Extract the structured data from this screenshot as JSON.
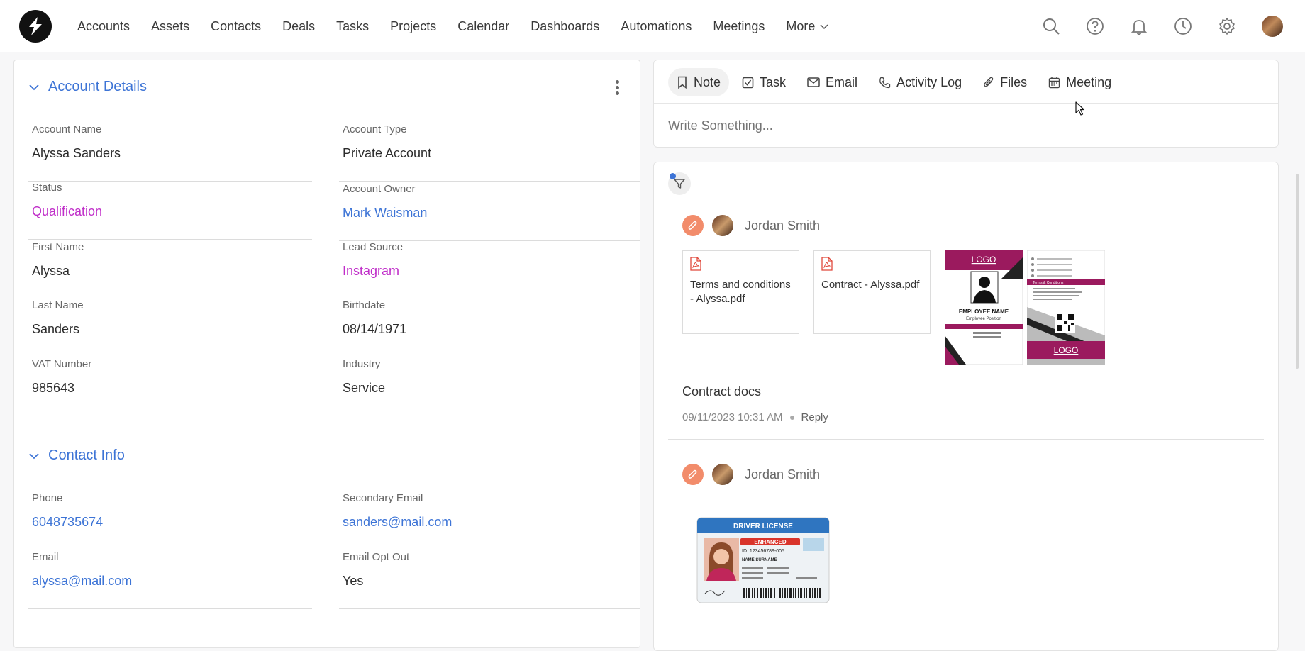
{
  "nav": {
    "items": [
      "Accounts",
      "Assets",
      "Contacts",
      "Deals",
      "Tasks",
      "Projects",
      "Calendar",
      "Dashboards",
      "Automations",
      "Meetings"
    ],
    "more_label": "More",
    "icons": [
      "search-icon",
      "help-icon",
      "bell-icon",
      "clock-icon",
      "gear-icon"
    ]
  },
  "account_details": {
    "title": "Account Details",
    "fields": [
      {
        "label": "Account Name",
        "value": "Alyssa Sanders"
      },
      {
        "label": "Account Type",
        "value": "Private Account"
      },
      {
        "label": "Status",
        "value": "Qualification"
      },
      {
        "label": "Account Owner",
        "value": "Mark Waisman"
      },
      {
        "label": "First Name",
        "value": "Alyssa"
      },
      {
        "label": "Lead Source",
        "value": "Instagram"
      },
      {
        "label": "Last Name",
        "value": "Sanders"
      },
      {
        "label": "Birthdate",
        "value": "08/14/1971"
      },
      {
        "label": "VAT Number",
        "value": "985643"
      },
      {
        "label": "Industry",
        "value": "Service"
      }
    ]
  },
  "contact_info": {
    "title": "Contact Info",
    "fields": [
      {
        "label": "Phone",
        "value": "6048735674"
      },
      {
        "label": "Secondary Email",
        "value": "sanders@mail.com"
      },
      {
        "label": "Email",
        "value": "alyssa@mail.com"
      },
      {
        "label": "Email Opt Out",
        "value": "Yes"
      }
    ]
  },
  "composer": {
    "tabs": [
      "Note",
      "Task",
      "Email",
      "Activity Log",
      "Files",
      "Meeting"
    ],
    "active_tab": "Note",
    "placeholder": "Write Something..."
  },
  "feed": {
    "posts": [
      {
        "author": "Jordan Smith",
        "files": [
          "Terms and conditions - Alyssa.pdf",
          "Contract - Alyssa.pdf"
        ],
        "images": {
          "id_front": {
            "logo": "LOGO",
            "name": "EMPLOYEE NAME",
            "position": "Employee Position"
          },
          "id_back": {
            "logo": "LOGO",
            "terms": "Terms & Conditions"
          }
        },
        "text": "Contract docs",
        "timestamp": "09/11/2023 10:31 AM",
        "reply_label": "Reply"
      },
      {
        "author": "Jordan Smith",
        "images": {
          "license": {
            "title": "DRIVER LICENSE",
            "badge": "ENHANCED",
            "id": "ID: 123456789-005",
            "name": "NAME SURNAME"
          }
        }
      }
    ]
  },
  "colors": {
    "accent": "#3d74d6",
    "purple": "#c02ec9",
    "clip": "#f28c6b",
    "id_magenta": "#9b1a5e"
  }
}
